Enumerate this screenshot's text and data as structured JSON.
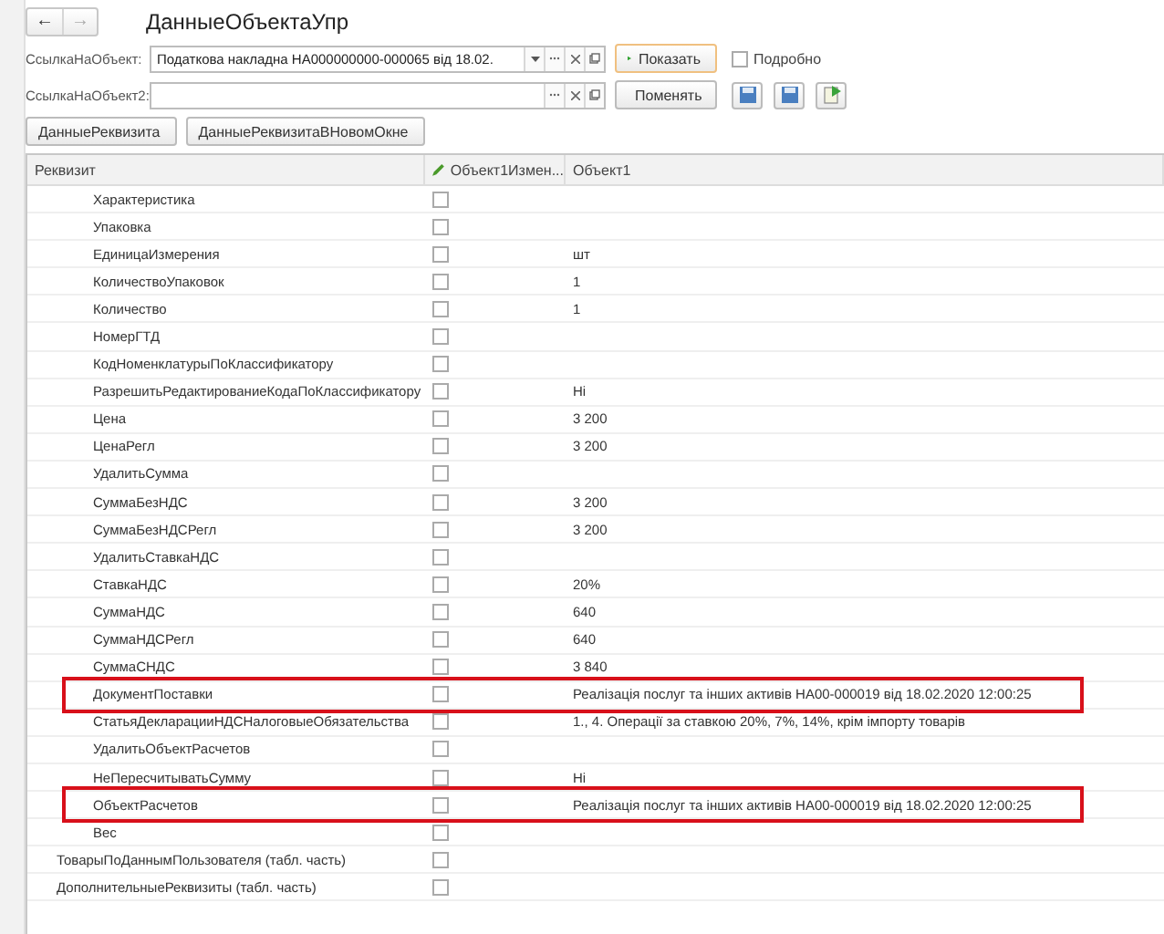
{
  "title": "ДанныеОбъектаУпр",
  "nav": {
    "back": "←",
    "forward": "→"
  },
  "fields": [
    {
      "label": "СсылкаНаОбъект:",
      "value": "Податкова накладна НА000000000-000065 від 18.02.",
      "dropdown": true,
      "button": {
        "kind": "show",
        "label": "Показать"
      }
    },
    {
      "label": "СсылкаНаОбъект2:",
      "dropdown": false,
      "button": {
        "kind": "swap",
        "label": "Поменять"
      }
    }
  ],
  "detailed": {
    "label": "Подробно",
    "checked": false
  },
  "buttons": [
    "ДанныеРеквизита",
    "ДанныеРеквизитаВНовомОкне"
  ],
  "table": {
    "columns": [
      "Реквизит",
      "Объект1Измен...",
      "Объект1"
    ],
    "rows": [
      {
        "children": [
          {
            "name": "Характеристика",
            "changed": false,
            "highlighted": false
          },
          {
            "name": "Упаковка",
            "changed": false,
            "highlighted": false
          },
          {
            "name": "ЕдиницаИзмерения",
            "changed": false,
            "value": "шт",
            "highlighted": false
          },
          {
            "name": "КоличествоУпаковок",
            "changed": false,
            "value": "1",
            "highlighted": false
          },
          {
            "name": "Количество",
            "changed": false,
            "value": "1",
            "highlighted": false
          },
          {
            "name": "НомерГТД",
            "changed": false,
            "highlighted": false
          },
          {
            "name": "КодНоменклатурыПоКлассификатору",
            "changed": false,
            "highlighted": false
          },
          {
            "name": "РазрешитьРедактированиеКодаПоКлассификатору",
            "changed": false,
            "value": "Hi",
            "highlighted": false
          },
          {
            "name": "Цена",
            "changed": false,
            "value": "3 200",
            "highlighted": false
          },
          {
            "name": "ЦенаРегл",
            "changed": false,
            "value": "3 200",
            "highlighted": false
          },
          {
            "name": "УдалитьСумма",
            "changed": false,
            "highlighted": false
          },
          {
            "name": "СуммаБезНДС",
            "changed": false,
            "value": "3 200",
            "highlighted": false
          },
          {
            "name": "СуммаБезНДСРегл",
            "changed": false,
            "value": "3 200",
            "highlighted": false
          },
          {
            "name": "УдалитьСтавкаНДС",
            "changed": false,
            "highlighted": false
          },
          {
            "name": "СтавкаНДС",
            "changed": false,
            "value": "20%",
            "highlighted": false
          },
          {
            "name": "СуммаНДС",
            "changed": false,
            "value": "640",
            "highlighted": false
          },
          {
            "name": "СуммаНДСРегл",
            "changed": false,
            "value": "640",
            "highlighted": false
          },
          {
            "name": "СуммаСНДС",
            "changed": false,
            "value": "3 840",
            "highlighted": false
          },
          {
            "name": "ДокументПоставки",
            "changed": false,
            "value": "Реалізація послуг та інших активів НА00-000019 від 18.02.2020 12:00:25",
            "highlighted": true
          },
          {
            "name": "СтатьяДекларацииНДСНалоговыеОбязательства",
            "changed": false,
            "value": "1., 4. Операції за ставкою 20%, 7%, 14%, крім імпорту товарів",
            "highlighted": false
          },
          {
            "name": "УдалитьОбъектРасчетов",
            "changed": false,
            "highlighted": false
          },
          {
            "name": "НеПересчитыватьСумму",
            "changed": false,
            "value": "Hi",
            "highlighted": false
          },
          {
            "name": "ОбъектРасчетов",
            "changed": false,
            "value": "Реалізація послуг та інших активів НА00-000019 від 18.02.2020 12:00:25",
            "highlighted": true
          },
          {
            "name": "Вес",
            "changed": false,
            "highlighted": false
          }
        ]
      },
      {
        "name": "ТоварыПоДаннымПользователя (табл. часть)",
        "changed": false,
        "highlighted": false
      },
      {
        "name": "ДополнительныеРеквизиты (табл. часть)",
        "changed": false,
        "highlighted": false
      }
    ]
  }
}
